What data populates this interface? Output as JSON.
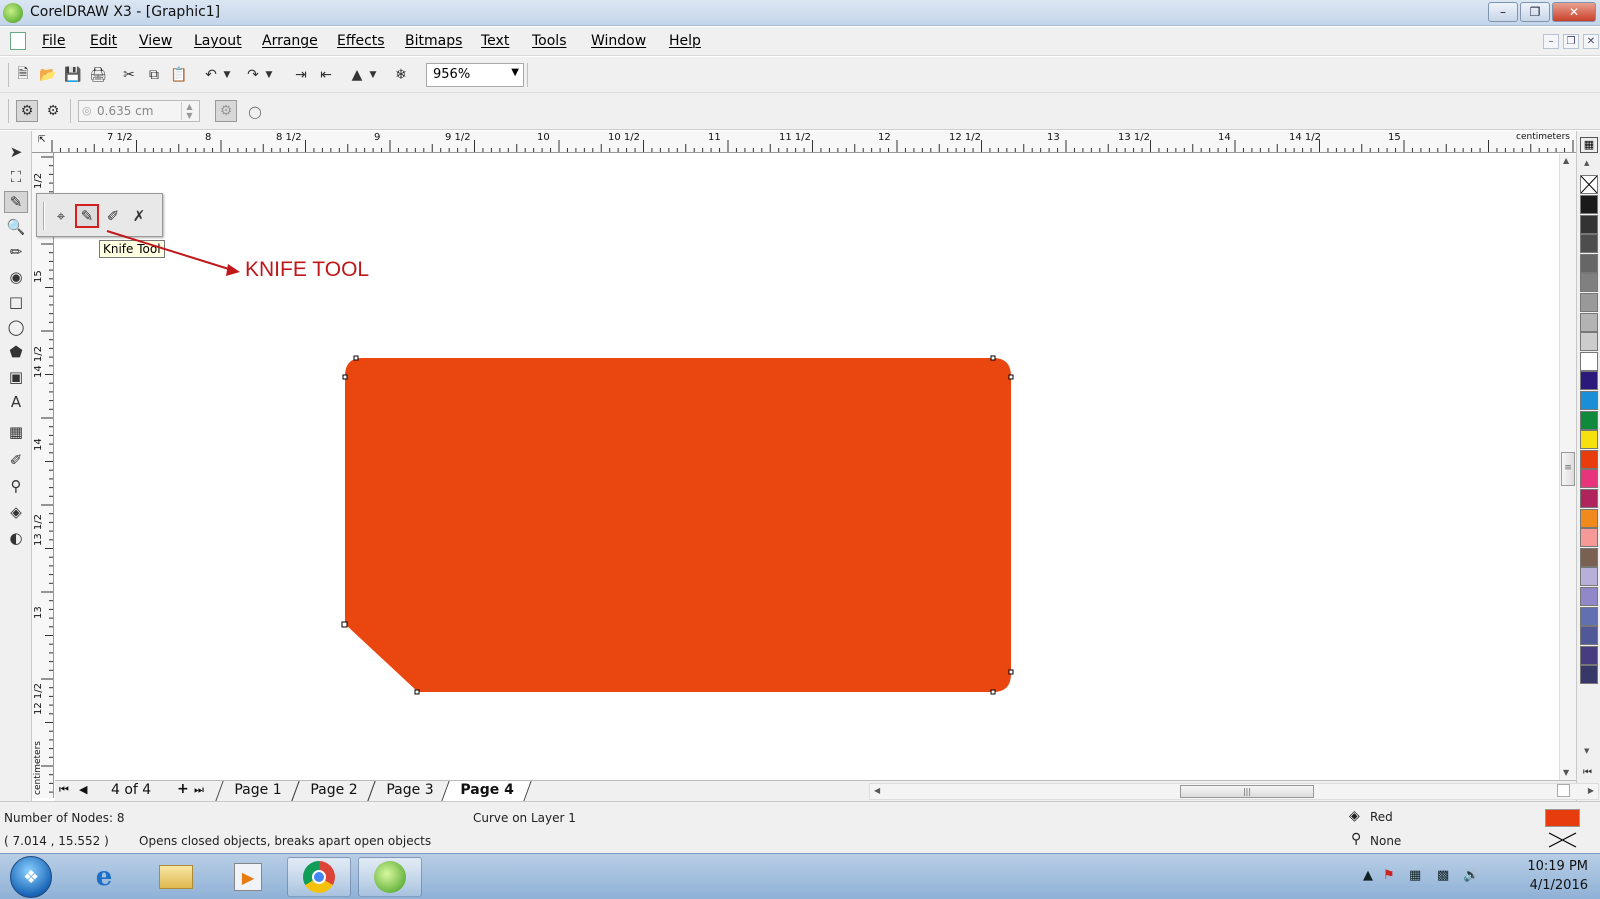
{
  "window": {
    "title": "CorelDRAW X3 - [Graphic1]"
  },
  "menu": {
    "items": [
      "File",
      "Edit",
      "View",
      "Layout",
      "Arrange",
      "Effects",
      "Bitmaps",
      "Text",
      "Tools",
      "Window",
      "Help"
    ]
  },
  "toolbar": {
    "zoom_value": "956%",
    "nudge_value": "0.635 cm"
  },
  "ruler": {
    "top_labels": [
      "7 1/2",
      "8",
      "8 1/2",
      "9",
      "9 1/2",
      "10",
      "10 1/2",
      "11",
      "11 1/2",
      "12",
      "12 1/2",
      "13",
      "13 1/2",
      "14",
      "14 1/2",
      "15"
    ],
    "top_unit": "centimeters",
    "left_labels": [
      "1/2",
      "15",
      "14 1/2",
      "14",
      "13 1/2",
      "13",
      "12 1/2"
    ],
    "left_unit": "centimeters"
  },
  "flyout": {
    "tooltip": "Knife Tool",
    "annotation": "KNIFE TOOL",
    "icons": [
      "crop-icon",
      "knife-icon",
      "eraser-icon",
      "virtual-segment-delete-icon"
    ]
  },
  "shape": {
    "fill_color": "#e94610",
    "outline": "none"
  },
  "pages": {
    "counter": "4 of 4",
    "tabs": [
      "Page 1",
      "Page 2",
      "Page 3",
      "Page 4"
    ],
    "active": "Page 4"
  },
  "status": {
    "nodes": "Number of Nodes: 8",
    "layer": "Curve on Layer 1",
    "coords": "( 7.014 , 15.552 )",
    "hint": "Opens closed objects, breaks apart open objects",
    "fill_label": "Red",
    "outline_label": "None",
    "fill_color": "#e63c0e"
  },
  "palette": {
    "colors": [
      "#1a1a1a",
      "#333333",
      "#4d4d4d",
      "#666666",
      "#808080",
      "#999999",
      "#b3b3b3",
      "#cccccc",
      "#ffffff",
      "#2b1a7a",
      "#1a8fd8",
      "#0f8a3c",
      "#f5e20c",
      "#e63c0e",
      "#e8347a",
      "#b0245e",
      "#f08a1c",
      "#f59a96",
      "#7a6050",
      "#b8b0d8",
      "#9088c8",
      "#6070b0",
      "#505898",
      "#483c80",
      "#383868"
    ]
  },
  "taskbar": {
    "time": "10:19 PM",
    "date": "4/1/2016",
    "apps": [
      "internet-explorer-icon",
      "file-explorer-icon",
      "media-player-icon",
      "chrome-icon",
      "coreldraw-icon"
    ]
  }
}
